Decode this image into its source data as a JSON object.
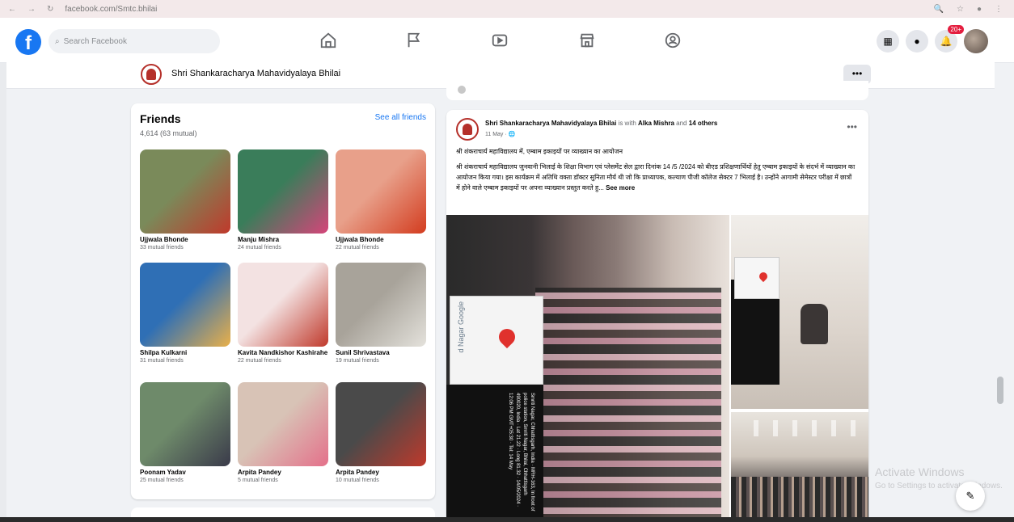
{
  "browser": {
    "url": "facebook.com/Smtc.bhilai"
  },
  "header": {
    "logo_letter": "f",
    "search_placeholder": "Search Facebook",
    "notification_count": "20+"
  },
  "page": {
    "name": "Shri Shankaracharya Mahavidyalaya Bhilai",
    "more_label": "•••"
  },
  "friends": {
    "title": "Friends",
    "count": "4,614 (63 mutual)",
    "see_all": "See all friends",
    "items": [
      {
        "name": "Ujjwala Bhonde",
        "mutual": "33 mutual friends",
        "colors": [
          "#7a8a5a",
          "#c0392b"
        ]
      },
      {
        "name": "Manju Mishra",
        "mutual": "24 mutual friends",
        "colors": [
          "#3a7d5a",
          "#d6457a"
        ]
      },
      {
        "name": "Ujjwala Bhonde",
        "mutual": "22 mutual friends",
        "colors": [
          "#e8a08a",
          "#d33c1f"
        ]
      },
      {
        "name": "Shilpa Kulkarni",
        "mutual": "31 mutual friends",
        "colors": [
          "#2f6fb5",
          "#e9b04a"
        ]
      },
      {
        "name": "Kavita Nandkishor Kashirahe",
        "mutual": "22 mutual friends",
        "colors": [
          "#f3e2e2",
          "#c0392b"
        ]
      },
      {
        "name": "Sunil Shrivastava",
        "mutual": "19 mutual friends",
        "colors": [
          "#a8a39a",
          "#e4e2dc"
        ]
      },
      {
        "name": "Poonam Yadav",
        "mutual": "25 mutual friends",
        "colors": [
          "#6e8a6a",
          "#3a3a4a"
        ]
      },
      {
        "name": "Arpita Pandey",
        "mutual": "5 mutual friends",
        "colors": [
          "#d8c3b6",
          "#e4708a"
        ]
      },
      {
        "name": "Arpita Pandey",
        "mutual": "10 mutual friends",
        "colors": [
          "#4a4a4a",
          "#c0392b"
        ]
      }
    ]
  },
  "post": {
    "author": "Shri Shankaracharya Mahavidyalaya Bhilai",
    "with_text": "is with",
    "tagged": "Alka Mishra",
    "and_text": "and",
    "others": "14 others",
    "time": "11 May · 🌐",
    "menu": "•••",
    "title": "श्री शंकराचार्य महाविद्यालय में, एम्बाम इकाइयों पर व्याख्यान का आयोजन",
    "body": "श्री शंकराचार्य महाविद्यालय जुनवानी भिलाई के शिक्षा विभाग एवं प्लेसमेंट सेल द्वारा दिनांक 14 /5 /2024 को बीएड प्रशिक्षणार्थियों हेतु एम्बाम इकाइयों के संदर्भ में व्याख्यान का आयोजन किया गया। इस कार्यक्रम में अतिथि वक्ता डॉक्टर सुनिता मौर्य थी जो कि प्राध्यापक, कल्याण पीजी कॉलेज सेक्टर 7 भिलाई है। उन्होंने आगामी सेमेस्टर परीक्षा में छात्रों में होने वाले एम्बाम इकाइयों पर अपना व्याख्यान प्रस्तुत करते हु...",
    "see_more": "See more",
    "map_label": "d Nagar Google",
    "map_caption": "Smriti Nagar, Chhattisgarh, India · MRH-163, In front of police station, Smriti Nagar, Bhilai, Chhattisgarh 490020, India · Lat 21.22 · Long 81.32 · 14/05/2024 · 12:06 PM GMT+05:30 · Tel: 14 May"
  },
  "watermark": {
    "line1": "Activate Windows",
    "line2": "Go to Settings to activate Windows."
  },
  "compose_icon": "✎"
}
